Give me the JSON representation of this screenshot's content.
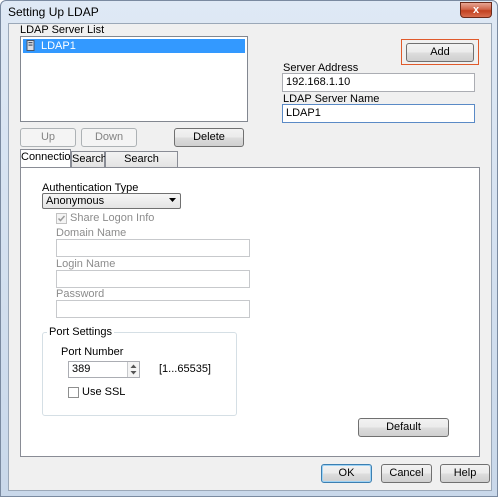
{
  "window": {
    "title": "Setting Up LDAP",
    "close_label": "x"
  },
  "server_list": {
    "label": "LDAP Server List",
    "items": [
      {
        "label": "LDAP1",
        "selected": true
      }
    ],
    "up_label": "Up",
    "down_label": "Down",
    "delete_label": "Delete"
  },
  "add_label": "Add",
  "server_address": {
    "label": "Server Address",
    "value": "192.168.1.10"
  },
  "server_name": {
    "label": "LDAP Server Name",
    "value": "LDAP1"
  },
  "tabs": [
    {
      "label": "Connection",
      "active": true
    },
    {
      "label": "Search",
      "active": false
    },
    {
      "label": "Search Attributes",
      "active": false
    }
  ],
  "connection": {
    "auth_type_label": "Authentication Type",
    "auth_type_value": "Anonymous",
    "share_logon_label": "Share Logon Info",
    "share_logon_checked": true,
    "domain_name_label": "Domain Name",
    "domain_name_value": "",
    "login_name_label": "Login Name",
    "login_name_value": "",
    "password_label": "Password",
    "password_value": "",
    "port_settings_label": "Port Settings",
    "port_number_label": "Port Number",
    "port_number_value": "389",
    "port_range": "[1...65535]",
    "use_ssl_label": "Use SSL",
    "use_ssl_checked": false,
    "default_label": "Default"
  },
  "footer": {
    "ok_label": "OK",
    "cancel_label": "Cancel",
    "help_label": "Help"
  },
  "colors": {
    "selection": "#3399ff",
    "highlight_border": "#e05a2b",
    "close_button": "#c2401f"
  }
}
